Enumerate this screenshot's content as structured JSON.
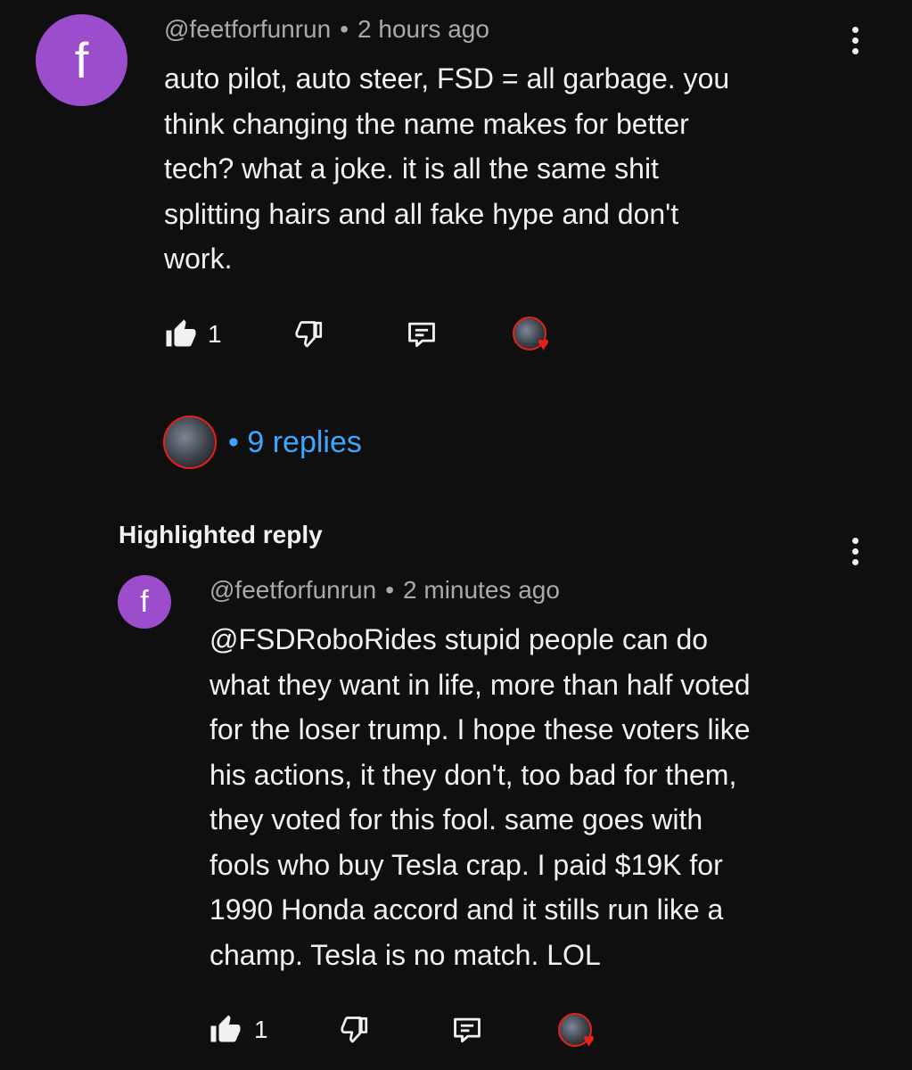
{
  "comment": {
    "avatar_letter": "f",
    "username": "@feetforfunrun",
    "separator": "•",
    "timestamp": "2 hours ago",
    "text": "auto pilot, auto steer, FSD = all garbage. you\nthink changing the name makes for better\ntech? what a joke. it is all the same shit\nsplitting hairs and all fake hype and don't\nwork.",
    "like_count": "1",
    "replies": {
      "separator": "•",
      "label": "9 replies"
    }
  },
  "highlighted_reply": {
    "section_label": "Highlighted reply",
    "avatar_letter": "f",
    "username": "@feetforfunrun",
    "separator": "•",
    "timestamp": "2 minutes ago",
    "text": "@FSDRoboRides stupid people can do\nwhat they want in life, more than half voted\nfor the loser trump. I hope these voters like\nhis actions, it they don't, too bad for them,\nthey voted for this fool. same goes with\nfools who buy Tesla crap. I paid $19K for\n1990 Honda accord and it stills run like a\nchamp. Tesla is no match. LOL",
    "like_count": "1"
  },
  "icons": {
    "like": "thumbs-up-icon",
    "dislike": "thumbs-down-icon",
    "reply": "reply-comment-icon",
    "more": "more-vert-icon",
    "creator_heart": "heart-icon"
  },
  "colors": {
    "background": "#0f0f0f",
    "avatar": "#9c4dcc",
    "link": "#3ea6ff",
    "meta_text": "#aaaaaa",
    "heart": "#e62117"
  }
}
